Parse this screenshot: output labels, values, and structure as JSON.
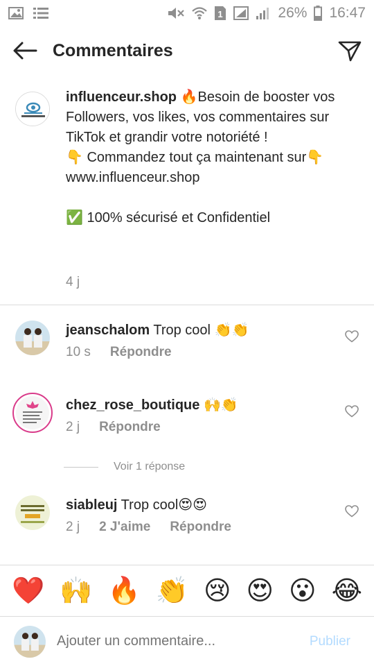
{
  "status_bar": {
    "battery_percent": "26%",
    "time": "16:47",
    "sim_label": "1"
  },
  "header": {
    "title": "Commentaires",
    "back_icon": "back-arrow-icon",
    "send_icon": "send-icon"
  },
  "caption": {
    "username": "influenceur.shop",
    "line1": " 🔥Besoin de booster vos Followers, vos likes, vos commentaires sur TikTok et grandir votre notoriété !",
    "line2": "👇 Commandez tout ça maintenant sur👇",
    "line3": " www.influenceur.shop",
    "line4": "✅ 100% sécurisé et Confidentiel",
    "time": "4 j"
  },
  "comments": [
    {
      "username": "jeanschalom",
      "text": " Trop cool 👏👏",
      "time": "10 s",
      "likes": "",
      "reply": "Répondre"
    },
    {
      "username": "chez_rose_boutique",
      "text": " 🙌👏",
      "time": "2 j",
      "likes": "",
      "reply": "Répondre"
    },
    {
      "username": "siableuj",
      "text": " Trop cool😍😍",
      "time": "2 j",
      "likes": "2 J'aime",
      "reply": "Répondre"
    }
  ],
  "view_replies": "Voir 1 réponse",
  "emoji_bar": [
    "❤️",
    "🙌",
    "🔥",
    "👏",
    "😢",
    "😍",
    "😮",
    "😂"
  ],
  "composer": {
    "placeholder": "Ajouter un commentaire...",
    "publish": "Publier"
  },
  "colors": {
    "text": "#262626",
    "secondary": "#8e8e8e",
    "divider": "#dbdbdb",
    "publish_disabled": "#b3dbff"
  }
}
